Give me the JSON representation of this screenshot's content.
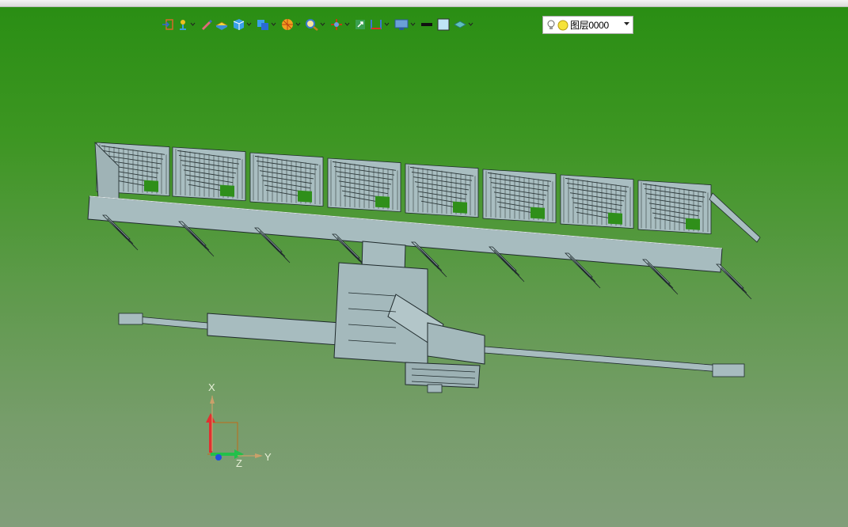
{
  "toolbar": {
    "buttons": [
      {
        "name": "exit-sketch",
        "has_menu": false
      },
      {
        "name": "snap-point",
        "has_menu": true
      },
      {
        "name": "pen",
        "has_menu": false
      },
      {
        "name": "solid-shading",
        "has_menu": false
      },
      {
        "name": "box-view",
        "has_menu": true
      },
      {
        "name": "view-orient",
        "has_menu": true
      },
      {
        "name": "render-style",
        "has_menu": true
      },
      {
        "name": "zoom",
        "has_menu": true
      },
      {
        "name": "move-axis",
        "has_menu": true
      },
      {
        "name": "fit-view",
        "has_menu": false
      },
      {
        "name": "section",
        "has_menu": true
      },
      {
        "name": "display",
        "has_menu": true
      },
      {
        "name": "line-color",
        "has_menu": false
      },
      {
        "name": "fill-color",
        "has_menu": false
      },
      {
        "name": "layer-style",
        "has_menu": true
      }
    ],
    "layer": {
      "name": "图层0000"
    }
  },
  "colors": {
    "viewport_top": "#2a8e14",
    "viewport_bottom": "#819e7a",
    "model_fill": "#a7bcbf",
    "model_edge": "#1f2a2c"
  },
  "triad": {
    "x_label": "X",
    "y_label": "Y",
    "z_label": "Z"
  }
}
